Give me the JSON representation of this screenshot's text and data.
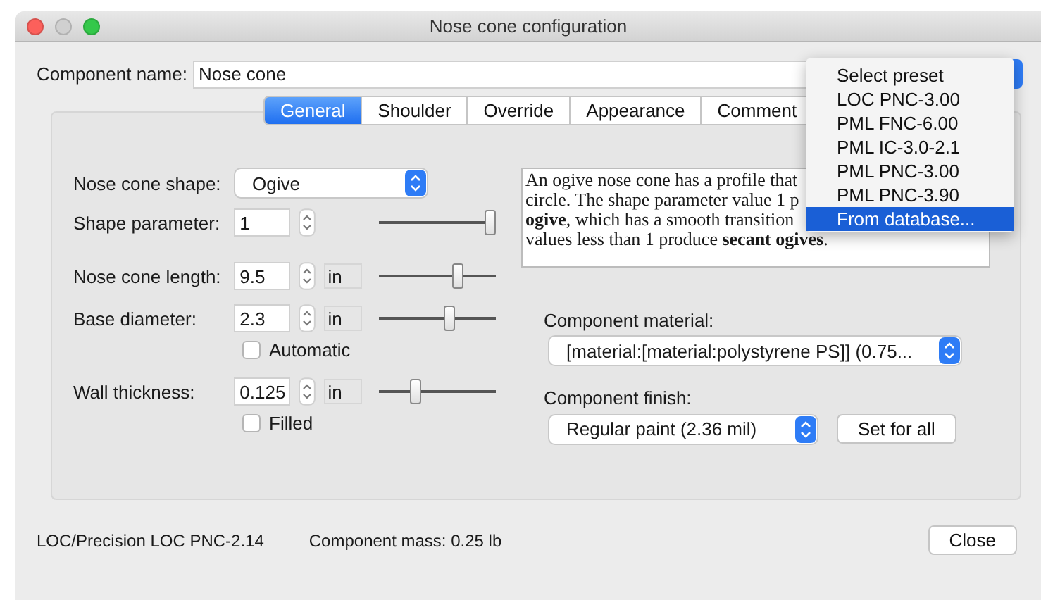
{
  "window": {
    "title": "Nose cone configuration"
  },
  "component_name": {
    "label": "Component name:",
    "value": "Nose cone"
  },
  "preset_menu": {
    "items": [
      {
        "label": "Select preset",
        "selected": false
      },
      {
        "label": "LOC PNC-3.00",
        "selected": false
      },
      {
        "label": "PML FNC-6.00",
        "selected": false
      },
      {
        "label": "PML IC-3.0-2.1",
        "selected": false
      },
      {
        "label": "PML PNC-3.00",
        "selected": false
      },
      {
        "label": "PML PNC-3.90",
        "selected": false
      },
      {
        "label": "From database...",
        "selected": true
      }
    ]
  },
  "tabs": [
    {
      "label": "General",
      "selected": true
    },
    {
      "label": "Shoulder",
      "selected": false
    },
    {
      "label": "Override",
      "selected": false
    },
    {
      "label": "Appearance",
      "selected": false
    },
    {
      "label": "Comment",
      "selected": false
    }
  ],
  "shape": {
    "label": "Nose cone shape:",
    "value": "Ogive"
  },
  "parameters": [
    {
      "kind": "plain",
      "label": "Shape parameter:",
      "value": "1",
      "level": 1
    },
    {
      "kind": "unit",
      "label": "Nose cone length:",
      "value": "9.5",
      "unit": "in",
      "level": 0.7
    },
    {
      "kind": "unit",
      "label": "Base diameter:",
      "value": "2.3",
      "unit": "in",
      "level": 0.62,
      "option": {
        "label": "Automatic",
        "checked": false
      }
    },
    {
      "kind": "unit",
      "label": "Wall thickness:",
      "value": "0.125",
      "unit": "in",
      "level": 0.3,
      "option": {
        "label": "Filled",
        "checked": false
      }
    }
  ],
  "description_lines": [
    "An ogive nose cone has a profile that",
    "circle. The shape parameter value 1 p",
    "**ogive**, which has a smooth transition",
    "values less than 1 produce **secant ogives**."
  ],
  "material": {
    "label": "Component material:",
    "value": "[material:[material:polystyrene PS]] (0.75..."
  },
  "finish": {
    "label": "Component finish:",
    "value": "Regular paint (2.36 mil)",
    "button": "Set for all"
  },
  "status": {
    "preset": "LOC/Precision LOC PNC-2.14",
    "mass": "Component mass: 0.25 lb"
  },
  "buttons": [
    "Close"
  ]
}
